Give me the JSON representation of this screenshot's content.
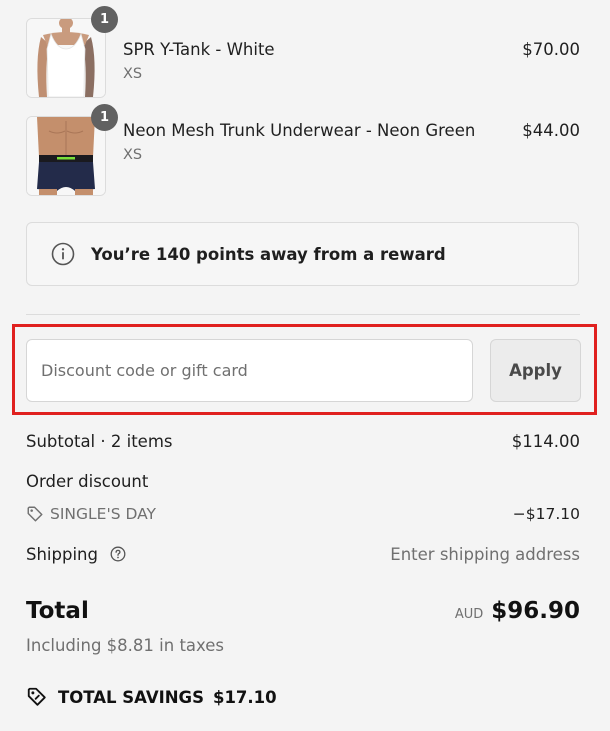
{
  "line_items": [
    {
      "quantity": "1",
      "title": "SPR Y-Tank - White",
      "variant": "XS",
      "price": "$70.00",
      "image_icon": "white-tank-top-photo"
    },
    {
      "quantity": "1",
      "title": "Neon Mesh Trunk Underwear - Neon Green",
      "variant": "XS",
      "price": "$44.00",
      "image_icon": "trunk-underwear-photo"
    }
  ],
  "rewards": {
    "message": "You’re 140 points away from a reward",
    "icon": "info-icon"
  },
  "discount": {
    "placeholder": "Discount code or gift card",
    "value": "",
    "apply_label": "Apply"
  },
  "summary": {
    "subtotal_label": "Subtotal · 2 items",
    "subtotal_value": "$114.00",
    "order_discount_label": "Order discount",
    "discount_code": "SINGLE'S DAY",
    "discount_value": "−$17.10",
    "shipping_label": "Shipping",
    "shipping_value": "Enter shipping address",
    "total_label": "Total",
    "currency": "AUD",
    "total_value": "$96.90",
    "taxes_note": "Including $8.81 in taxes",
    "savings_label": "TOTAL SAVINGS",
    "savings_value": "$17.10"
  },
  "colors": {
    "background": "#f4f4f4",
    "highlight_border": "#e0201f",
    "badge": "#616161",
    "muted_text": "#707070"
  }
}
